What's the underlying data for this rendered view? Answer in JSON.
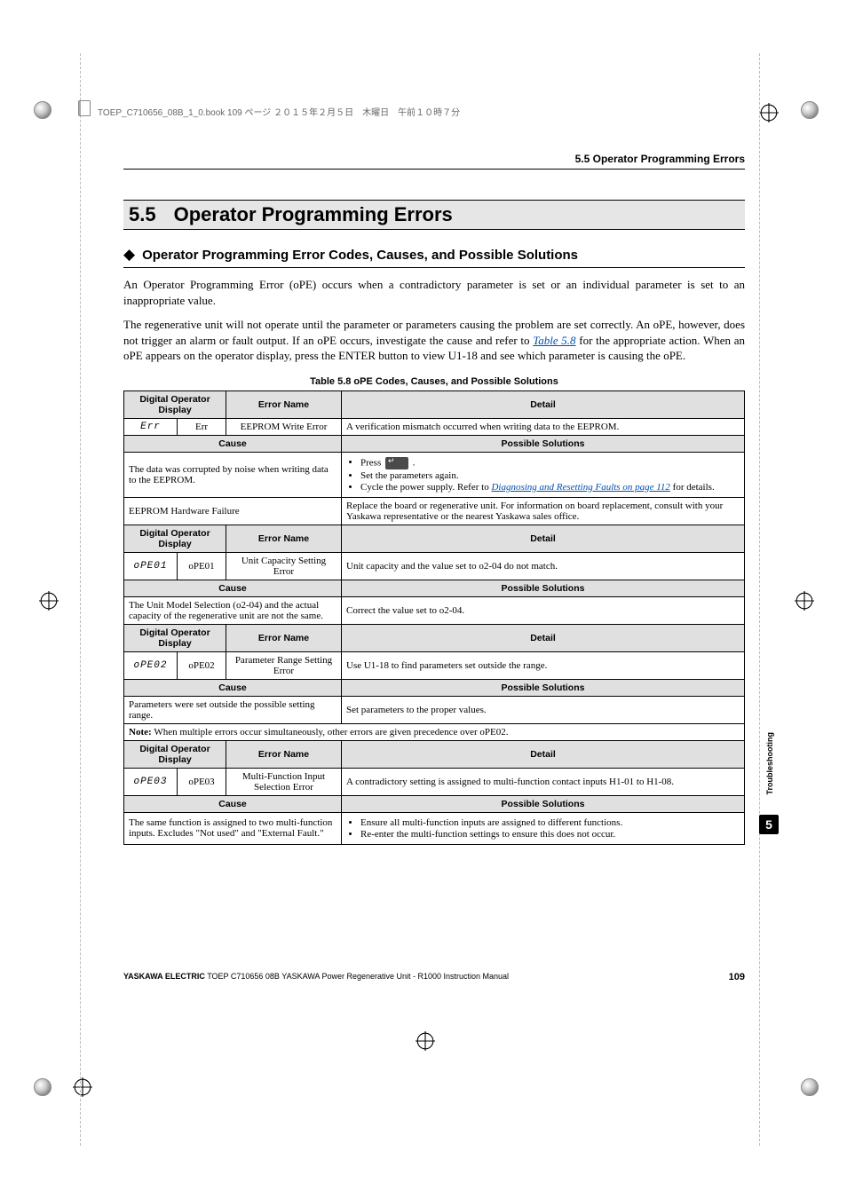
{
  "book_header": "TOEP_C710656_08B_1_0.book  109 ページ  ２０１５年２月５日　木曜日　午前１０時７分",
  "header_right": "5.5  Operator Programming Errors",
  "section": {
    "number": "5.5",
    "title": "Operator Programming Errors"
  },
  "subsection": {
    "diamond": "◆",
    "title": "Operator Programming Error Codes, Causes, and Possible Solutions"
  },
  "para1": "An Operator Programming Error (oPE) occurs when a contradictory parameter is set or an individual parameter is set to an inappropriate value.",
  "para2a": "The regenerative unit will not operate until the parameter or parameters causing the problem are set correctly. An oPE, however, does not trigger an alarm or fault output. If an oPE occurs, investigate the cause and refer to ",
  "para2_link": "Table 5.8",
  "para2b": " for the appropriate action. When an oPE appears on the operator display, press the ENTER button to view U1-18 and see which parameter is causing the oPE.",
  "table": {
    "caption": "Table 5.8  oPE Codes, Causes, and Possible Solutions",
    "hdr_display": "Digital Operator Display",
    "hdr_errname": "Error Name",
    "hdr_detail": "Detail",
    "hdr_cause": "Cause",
    "hdr_solutions": "Possible Solutions",
    "rows": [
      {
        "disp_seg": "Err",
        "disp_txt": "Err",
        "err_name": "EEPROM Write Error",
        "detail": "A verification mismatch occurred when writing data to the EEPROM.",
        "causes": [
          {
            "cause": "The data was corrupted by noise when writing data to the EEPROM.",
            "solution_pre": "Press ",
            "solution_bullets": [
              "Set the parameters again.",
              "Cycle the power supply. Refer to "
            ],
            "solution_link": "Diagnosing and Resetting Faults on page 112",
            "solution_post": " for details."
          },
          {
            "cause": "EEPROM Hardware Failure",
            "solution_text": "Replace the board or regenerative unit. For information on board replacement, consult with your Yaskawa representative or the nearest Yaskawa sales office."
          }
        ]
      },
      {
        "disp_seg": "oPE01",
        "disp_txt": "oPE01",
        "err_name": "Unit Capacity Setting Error",
        "detail": "Unit capacity and the value set to o2-04 do not match.",
        "causes": [
          {
            "cause": "The Unit Model Selection (o2-04) and the actual capacity of the regenerative unit are not the same.",
            "solution_text": "Correct the value set to o2-04."
          }
        ]
      },
      {
        "disp_seg": "oPE02",
        "disp_txt": "oPE02",
        "err_name": "Parameter Range Setting Error",
        "detail": "Use U1-18 to find parameters set outside the range.",
        "causes": [
          {
            "cause": "Parameters were set outside the possible setting range.",
            "solution_text": "Set parameters to the proper values."
          }
        ],
        "note": "When multiple errors occur simultaneously, other errors are given precedence over oPE02.",
        "note_label": "Note: "
      },
      {
        "disp_seg": "oPE03",
        "disp_txt": "oPE03",
        "err_name": "Multi-Function Input Selection Error",
        "detail": "A contradictory setting is assigned to multi-function contact inputs H1-01 to H1-08.",
        "causes": [
          {
            "cause": "The same function is assigned to two multi-function inputs. Excludes \"Not used\" and \"External Fault.\"",
            "solution_bullets": [
              "Ensure all multi-function inputs are assigned to different functions.",
              "Re-enter the multi-function settings to ensure this does not occur."
            ]
          }
        ]
      }
    ]
  },
  "side": {
    "label": "Troubleshooting",
    "num": "5"
  },
  "footer": {
    "brand": "YASKAWA ELECTRIC",
    "rest": " TOEP C710656 08B YASKAWA Power Regenerative Unit - R1000 Instruction Manual",
    "page": "109"
  }
}
